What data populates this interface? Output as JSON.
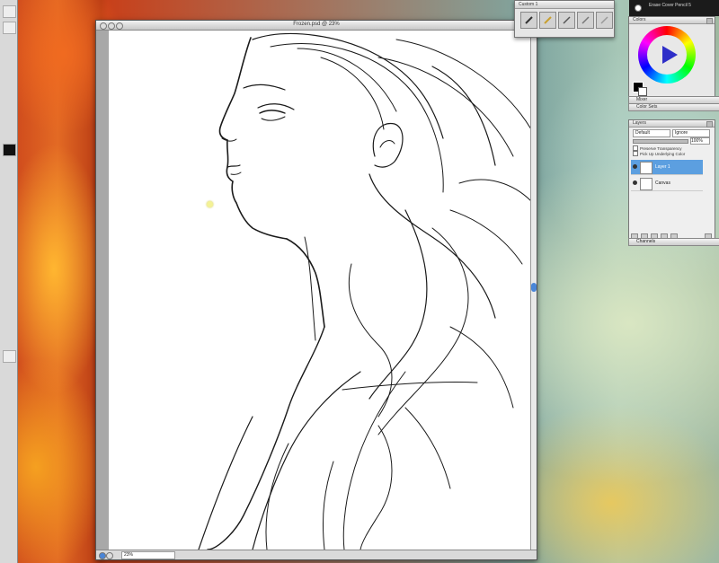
{
  "canvas_window": {
    "title": "Frozen.psd @ 23%",
    "zoom": "23%"
  },
  "brush_selector": {
    "title": "Custom 1",
    "brushes": [
      "brush-1",
      "brush-2",
      "brush-3",
      "brush-4",
      "brush-5"
    ]
  },
  "current_brush": {
    "label": "Erase Cover Pencil 5"
  },
  "colors_panel": {
    "title": "Colors",
    "fg_color": "#000000",
    "bg_color": "#ffffff"
  },
  "collapsed_panels": [
    {
      "label": "Mixer"
    },
    {
      "label": "Color Sets"
    }
  ],
  "layers_panel": {
    "title": "Layers",
    "composite_method": "Default",
    "depth": "Ignore",
    "opacity": "100%",
    "options": [
      "Preserve Transparency",
      "Pick Up Underlying Color"
    ],
    "layers": [
      {
        "name": "Layer 1",
        "selected": true
      },
      {
        "name": "Canvas",
        "selected": false
      }
    ]
  },
  "channels_panel": {
    "label": "Channels"
  },
  "colors": {
    "accent": "#5c9fe0",
    "scroll": "#4a86d8"
  }
}
